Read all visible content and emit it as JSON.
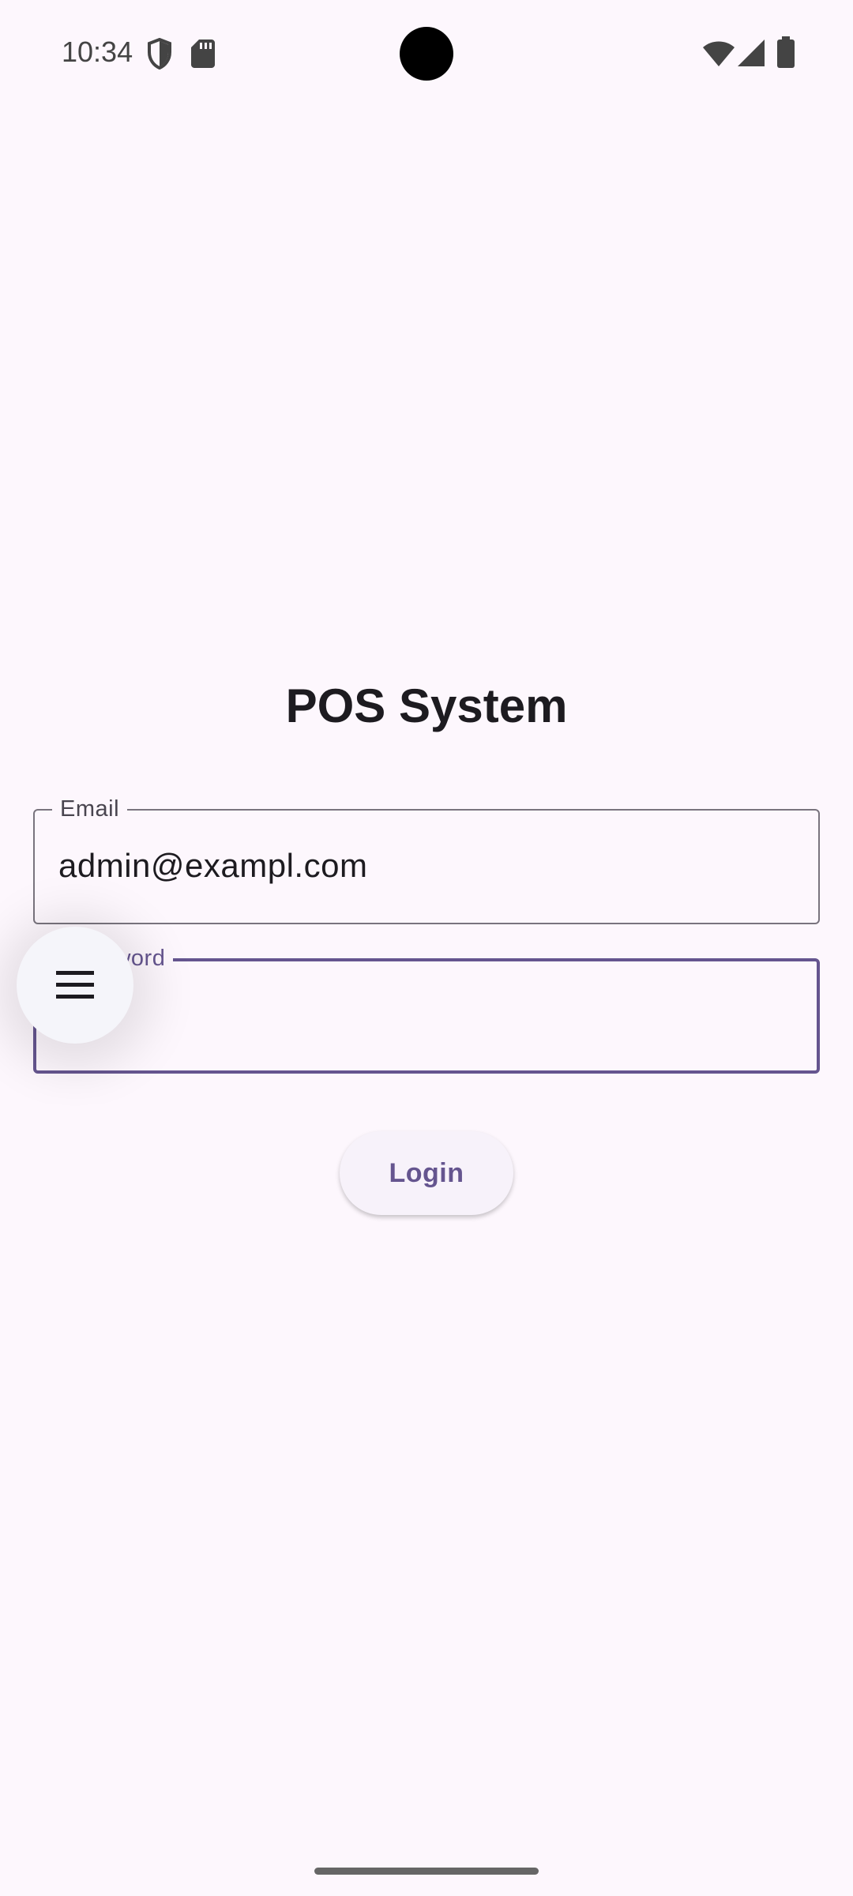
{
  "status_bar": {
    "time": "10:34",
    "left_icons": [
      "shield-icon",
      "sd-card-icon"
    ],
    "right_icons": [
      "wifi-icon",
      "cellular-signal-icon",
      "battery-icon"
    ]
  },
  "login": {
    "title": "POS System",
    "email_field": {
      "label": "Email",
      "value": "admin@exampl.com"
    },
    "password_field": {
      "label": "Password",
      "value": ""
    },
    "login_button_label": "Login"
  },
  "menu_fab": {
    "icon": "menu-icon"
  },
  "colors": {
    "background": "#fdf7fd",
    "primary": "#65558f",
    "outline": "#79747e",
    "text": "#1d1b20"
  }
}
